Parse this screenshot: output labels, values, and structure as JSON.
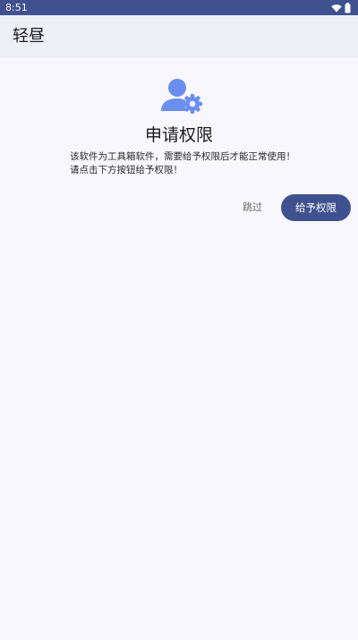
{
  "status_bar": {
    "time": "8:51",
    "icons": [
      "wifi-icon",
      "battery-icon"
    ]
  },
  "app_bar": {
    "title": "轻昼"
  },
  "permission": {
    "icon": "user-settings-icon",
    "title": "申请权限",
    "description_line1": "该软件为工具箱软件，需要给予权限后才能正常使用！",
    "description_line2": "请点击下方按钮给予权限！",
    "skip_label": "跳过",
    "grant_label": "给予权限"
  },
  "colors": {
    "primary": "#40518f",
    "icon_accent": "#6b8ff0",
    "background": "#f8f7fd",
    "app_bar": "#eeeef6"
  }
}
